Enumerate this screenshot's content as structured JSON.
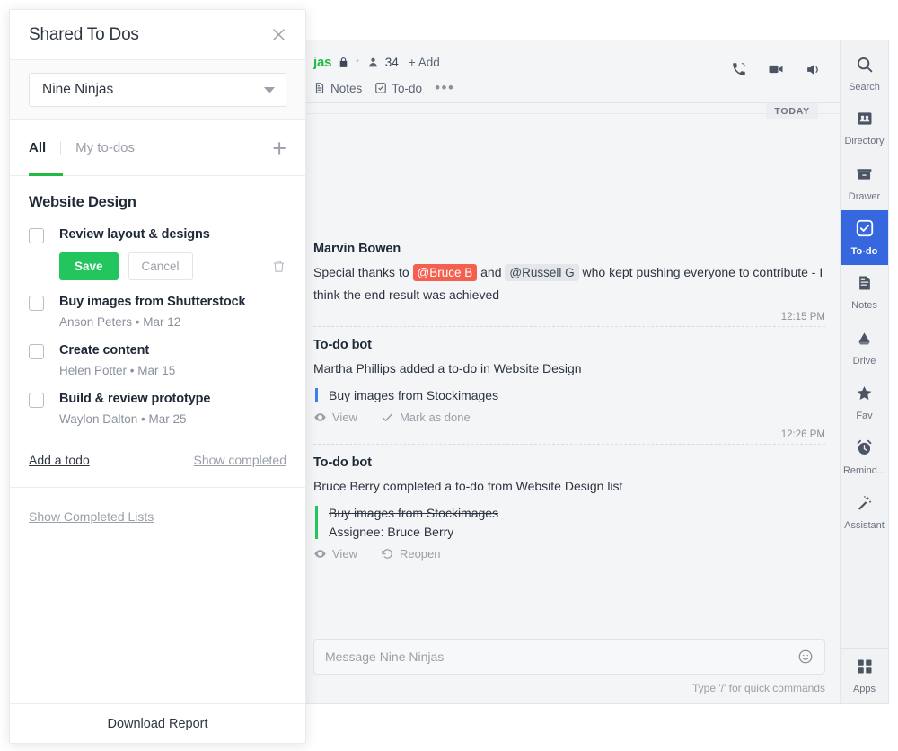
{
  "panel": {
    "title": "Shared To Dos",
    "close_icon": "close-icon",
    "team_select": {
      "value": "Nine Ninjas",
      "caret_icon": "chevron-down-icon"
    },
    "tabs": [
      {
        "label": "All",
        "active": true
      },
      {
        "label": "My to-dos",
        "active": false
      }
    ],
    "add_icon": "plus-icon",
    "list": {
      "title": "Website Design",
      "items": [
        {
          "label": "Review layout & designs",
          "meta": "",
          "editing": true,
          "save_label": "Save",
          "cancel_label": "Cancel",
          "delete_icon": "trash-icon"
        },
        {
          "label": "Buy images from Shutterstock",
          "meta": "Anson Peters  •  Mar 12",
          "editing": false
        },
        {
          "label": "Create content",
          "meta": "Helen Potter  •  Mar 15",
          "editing": false
        },
        {
          "label": "Build & review prototype",
          "meta": "Waylon Dalton  •  Mar 25",
          "editing": false
        }
      ],
      "add_todo_label": "Add a todo",
      "show_completed_label": "Show completed"
    },
    "show_completed_lists_label": "Show Completed Lists",
    "footer_label": "Download Report"
  },
  "chat": {
    "header": {
      "channel_name": "jas",
      "lock_icon": "lock-icon",
      "member_icon": "person-icon",
      "member_count": "34",
      "add_label": "+ Add",
      "tabs": [
        {
          "label": "Notes",
          "icon": "notes-icon"
        },
        {
          "label": "To-do",
          "icon": "check-circle-icon"
        }
      ],
      "more_label": "•••",
      "actions": [
        {
          "name": "call-icon"
        },
        {
          "name": "video-icon"
        },
        {
          "name": "speaker-icon"
        }
      ]
    },
    "day_divider": "TODAY",
    "messages": [
      {
        "author": "Marvin Bowen",
        "text_before": "Special thanks to ",
        "mention_self": "@Bruce B",
        "text_middle": " and ",
        "mention_other": "@Russell G",
        "text_after": " who kept pushing everyone to contribute - I think the end result was achieved",
        "time": "12:15 PM"
      },
      {
        "author": "To-do bot",
        "body": "Martha Phillips added a to-do in Website Design",
        "quote_title": "Buy images from Stockimages",
        "quote_sub": "",
        "actions": [
          {
            "label": "View",
            "icon": "eye-icon"
          },
          {
            "label": "Mark as done",
            "icon": "check-icon"
          }
        ],
        "time": "12:26 PM"
      },
      {
        "author": "To-do bot",
        "body": "Bruce Berry completed a to-do from Website Design list",
        "quote_title": "Buy images from Stockimages",
        "quote_sub": "Assignee: Bruce Berry",
        "actions": [
          {
            "label": "View",
            "icon": "eye-icon"
          },
          {
            "label": "Reopen",
            "icon": "reopen-icon"
          }
        ],
        "time": ""
      }
    ],
    "composer": {
      "placeholder": "Message Nine Ninjas",
      "emoji_icon": "emoji-icon",
      "hint": "Type '/' for quick commands"
    }
  },
  "rail": {
    "items": [
      {
        "label": "Search",
        "icon": "search-icon",
        "active": false
      },
      {
        "label": "Directory",
        "icon": "directory-icon",
        "active": false
      },
      {
        "label": "Drawer",
        "icon": "drawer-icon",
        "active": false
      },
      {
        "label": "To-do",
        "icon": "check-square-icon",
        "active": true
      },
      {
        "label": "Notes",
        "icon": "notes-icon",
        "active": false
      },
      {
        "label": "Drive",
        "icon": "drive-icon",
        "active": false
      },
      {
        "label": "Fav",
        "icon": "star-icon",
        "active": false
      },
      {
        "label": "Remind...",
        "icon": "alarm-icon",
        "active": false
      },
      {
        "label": "Assistant",
        "icon": "wand-icon",
        "active": false
      }
    ],
    "bottom": {
      "label": "Apps",
      "icon": "grid-icon"
    }
  },
  "colors": {
    "brand_green": "#21ba45",
    "save_green": "#22c55e",
    "rail_active_blue": "#3767de",
    "quote_blue": "#3e7ef0",
    "quote_green": "#22c55e",
    "mention_self_bg": "#f4604f"
  }
}
